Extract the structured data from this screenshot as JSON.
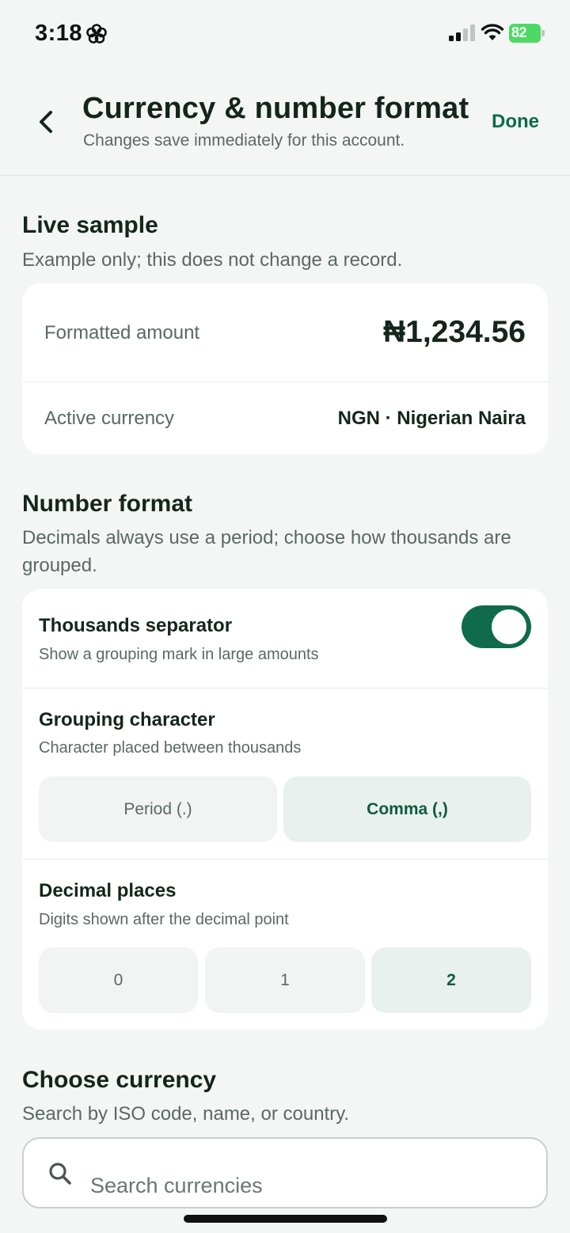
{
  "status_bar": {
    "time": "3:18",
    "battery_level": "82",
    "icons": [
      "focus-flower-icon",
      "cellular-signal-icon",
      "wifi-icon",
      "battery-charging-icon"
    ]
  },
  "header": {
    "title": "Currency & number format",
    "subtitle": "Changes save immediately for this account.",
    "done_label": "Done",
    "back_icon": "chevron-left-icon"
  },
  "live_sample": {
    "title": "Live sample",
    "description": "Example only; this does not change a record.",
    "rows": [
      {
        "label": "Formatted amount",
        "value": "₦1,234.56"
      },
      {
        "label": "Active currency",
        "value": "NGN · Nigerian Naira"
      }
    ]
  },
  "number_format": {
    "title": "Number format",
    "description": "Decimals always use a period; choose how thousands are grouped.",
    "thousands_separator": {
      "title": "Thousands separator",
      "description": "Show a grouping mark in large amounts",
      "enabled": true
    },
    "grouping_character": {
      "title": "Grouping character",
      "description": "Character placed between thousands",
      "options": [
        "Period (.)",
        "Comma (,)"
      ],
      "selected": "Comma (,)"
    },
    "decimal_places": {
      "title": "Decimal places",
      "description": "Digits shown after the decimal point",
      "options": [
        "0",
        "1",
        "2"
      ],
      "selected": "2"
    }
  },
  "choose_currency": {
    "title": "Choose currency",
    "description": "Search by ISO code, name, or country.",
    "search_placeholder": "Search currencies",
    "search_icon": "search-icon"
  },
  "colors": {
    "accent": "#0f6b4b",
    "selected_bg": "#e8f1ed",
    "page_bg": "#f4f6f5",
    "battery": "#4cd964"
  }
}
